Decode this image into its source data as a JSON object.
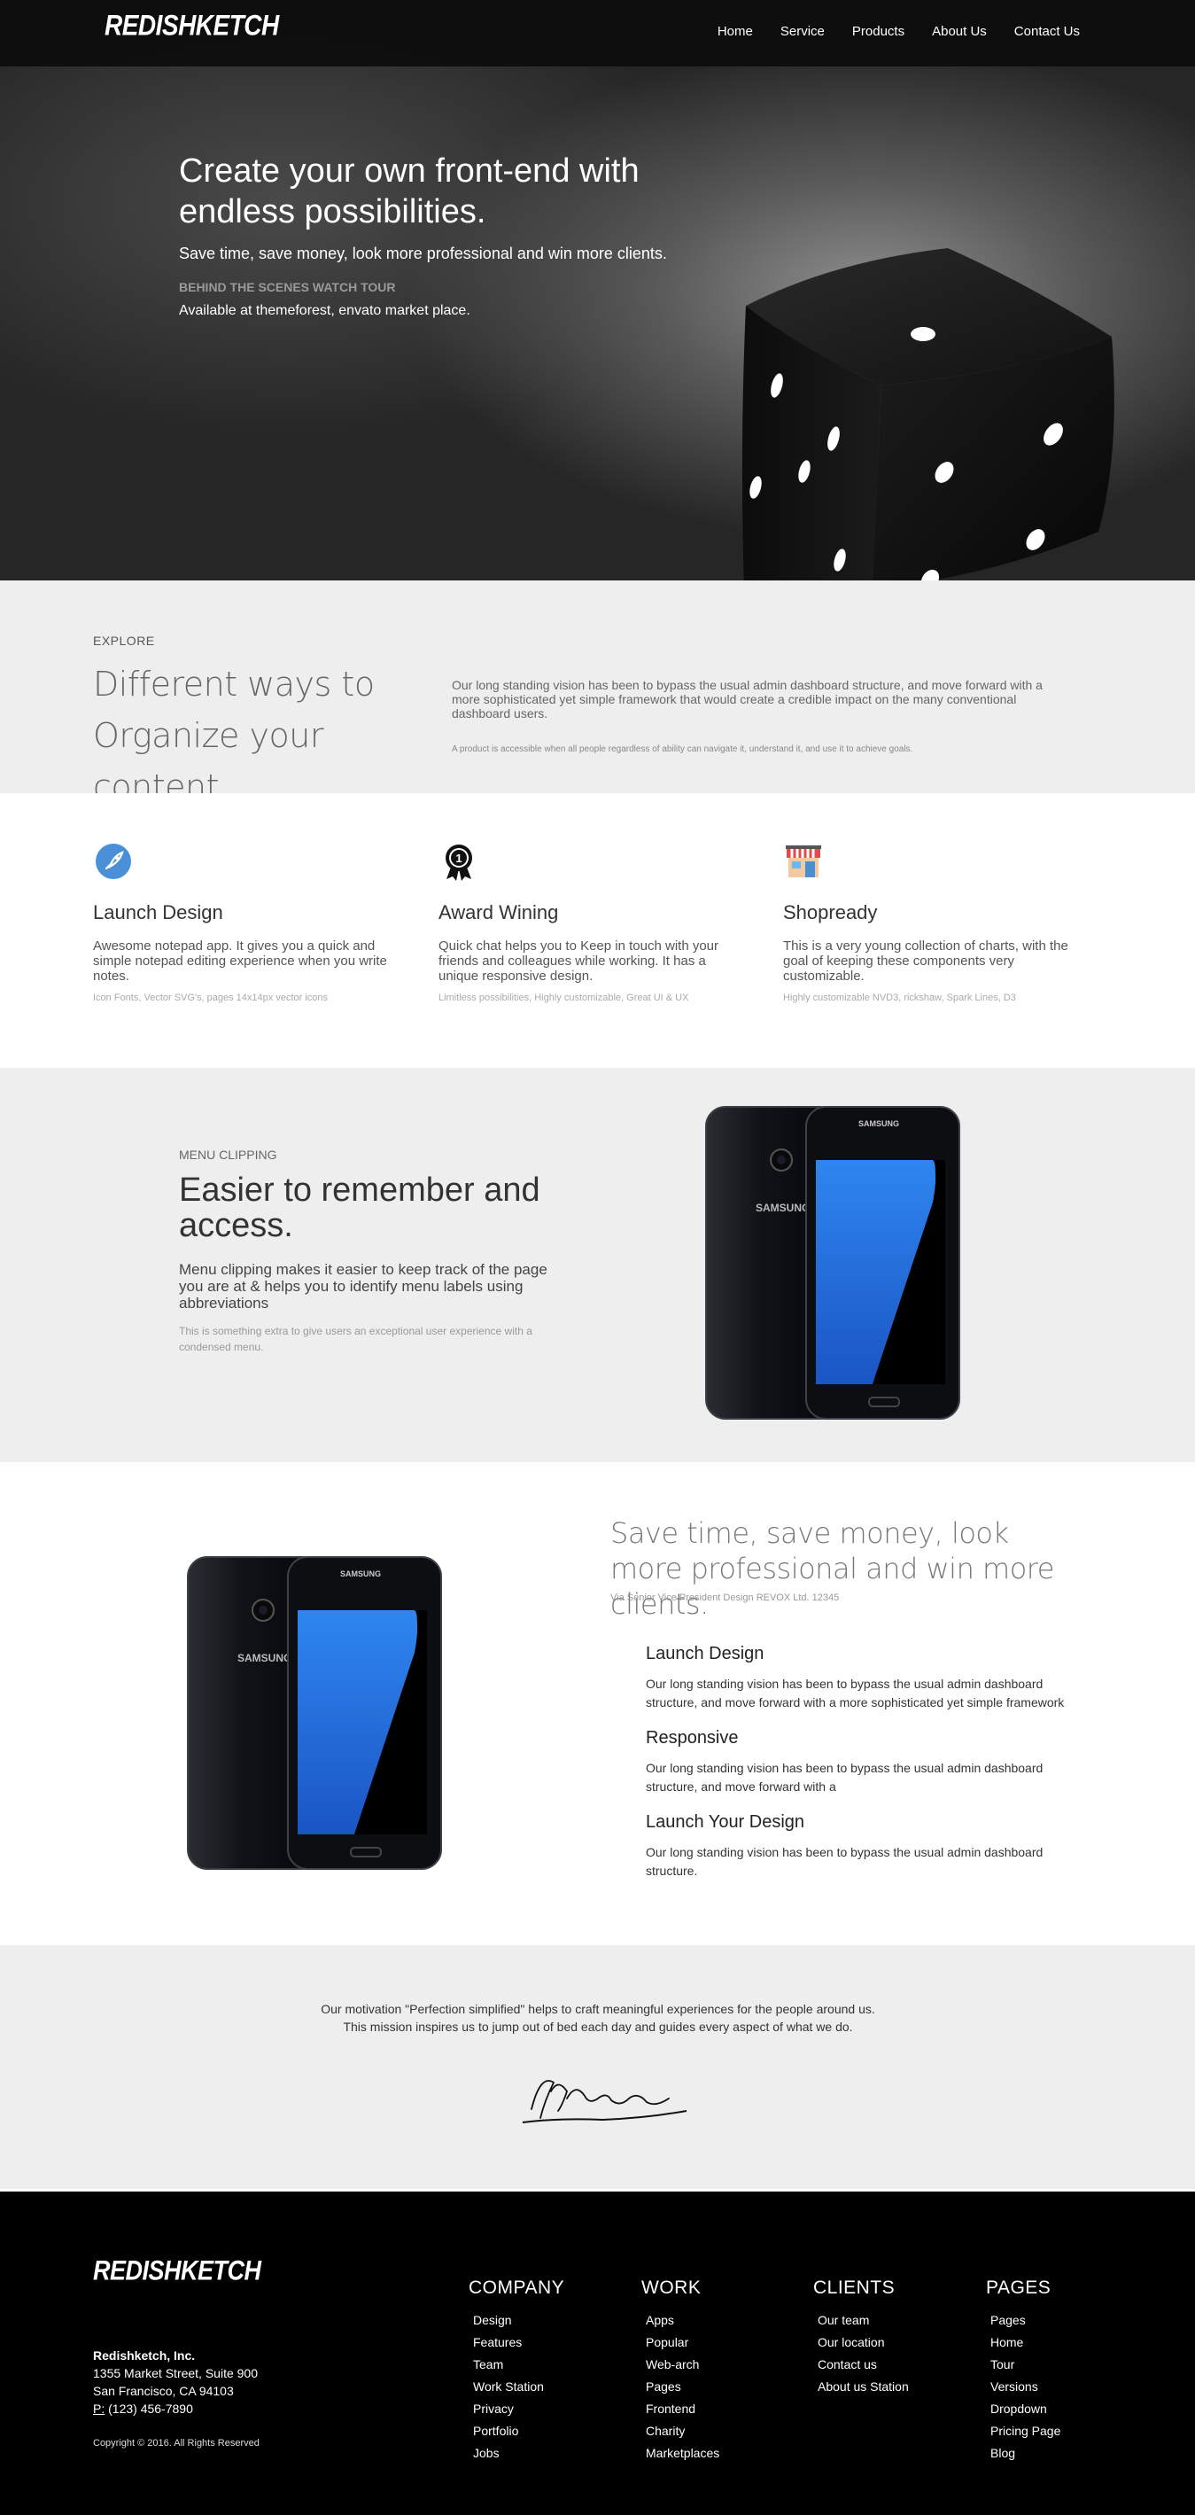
{
  "nav": {
    "logo": "REDISHKETCH",
    "links": [
      "Home",
      "Service",
      "Products",
      "About Us",
      "Contact Us"
    ]
  },
  "hero": {
    "title": "Create your own front-end with endless possibilities.",
    "subtitle": "Save time, save money, look more professional and win more clients.",
    "tour": "BEHIND THE SCENES WATCH TOUR",
    "available": "Available at themeforest, envato market place."
  },
  "explore": {
    "label": "EXPLORE",
    "title": "Different ways to Organize your content",
    "text": "Our long standing vision has been to bypass the usual admin dashboard structure, and move forward with a more sophisticated yet simple framework that would create a credible impact on the many conventional dashboard users.",
    "note": "A product is accessible when all people regardless of ability can navigate it, understand it, and use it to achieve goals."
  },
  "features": [
    {
      "icon": "rocket-icon",
      "title": "Launch Design",
      "text": "Awesome notepad app. It gives you a quick and simple notepad editing experience when you write notes.",
      "sub": "Icon Fonts, Vector SVG's, pages 14x14px vector icons"
    },
    {
      "icon": "award-ribbon-icon",
      "title": "Award Wining",
      "text": "Quick chat helps you to Keep in touch with your friends and colleagues while working. It has a unique responsive design.",
      "sub": "Limitless possibilities, Highly customizable, Great UI & UX"
    },
    {
      "icon": "shop-icon",
      "title": "Shopready",
      "text": "This is a very young collection of charts, with the goal of keeping these components very customizable.",
      "sub": "Highly customizable NVD3, rickshaw, Spark Lines, D3"
    }
  ],
  "clip": {
    "label": "MENU CLIPPING",
    "title": "Easier to remember and access.",
    "text": "Menu clipping makes it easier to keep track of the page you are at & helps you to identify menu labels using abbreviations",
    "note": "This is something extra to give users an exceptional user experience with a condensed menu.",
    "phone_brand": "SAMSUNG"
  },
  "save": {
    "title": "Save time, save money, look more professional and win more clients.",
    "via": "Via Senior Vice President Design REVOX Ltd. 12345",
    "items": [
      {
        "title": "Launch Design",
        "text": "Our long standing vision has been to bypass the usual admin dashboard structure, and move forward with a more sophisticated yet simple framework"
      },
      {
        "title": "Responsive",
        "text": "Our long standing vision has been to bypass the usual admin dashboard structure, and move forward with a"
      },
      {
        "title": "Launch Your Design",
        "text": "Our long standing vision has been to bypass the usual admin dashboard structure."
      }
    ],
    "phone_brand": "SAMSUNG"
  },
  "motivation": {
    "text": "Our motivation \"Perfection simplified\" helps to craft meaningful experiences for the people around us. This mission inspires us to jump out of bed each day and guides every aspect of what we do."
  },
  "footer": {
    "logo": "REDISHKETCH",
    "company_name": "Redishketch, Inc.",
    "address1": "1355 Market Street, Suite 900",
    "address2": "San Francisco, CA 94103",
    "phone_prefix": "P:",
    "phone": " (123) 456-7890",
    "copyright": "Copyright © 2016. All Rights Reserved",
    "columns": [
      {
        "title": "COMPANY",
        "links": [
          "Design",
          "Features",
          "Team",
          "Work Station",
          "Privacy",
          "Portfolio",
          "Jobs"
        ]
      },
      {
        "title": "WORK",
        "links": [
          "Apps",
          "Popular",
          "Web-arch",
          "Pages",
          "Frontend",
          "Charity",
          "Marketplaces"
        ]
      },
      {
        "title": "CLIENTS",
        "links": [
          "Our team",
          "Our location",
          "Contact us",
          "About us Station"
        ]
      },
      {
        "title": "PAGES",
        "links": [
          "Pages",
          "Home",
          "Tour",
          "Versions",
          "Dropdown",
          "Pricing Page",
          "Blog"
        ]
      }
    ]
  }
}
